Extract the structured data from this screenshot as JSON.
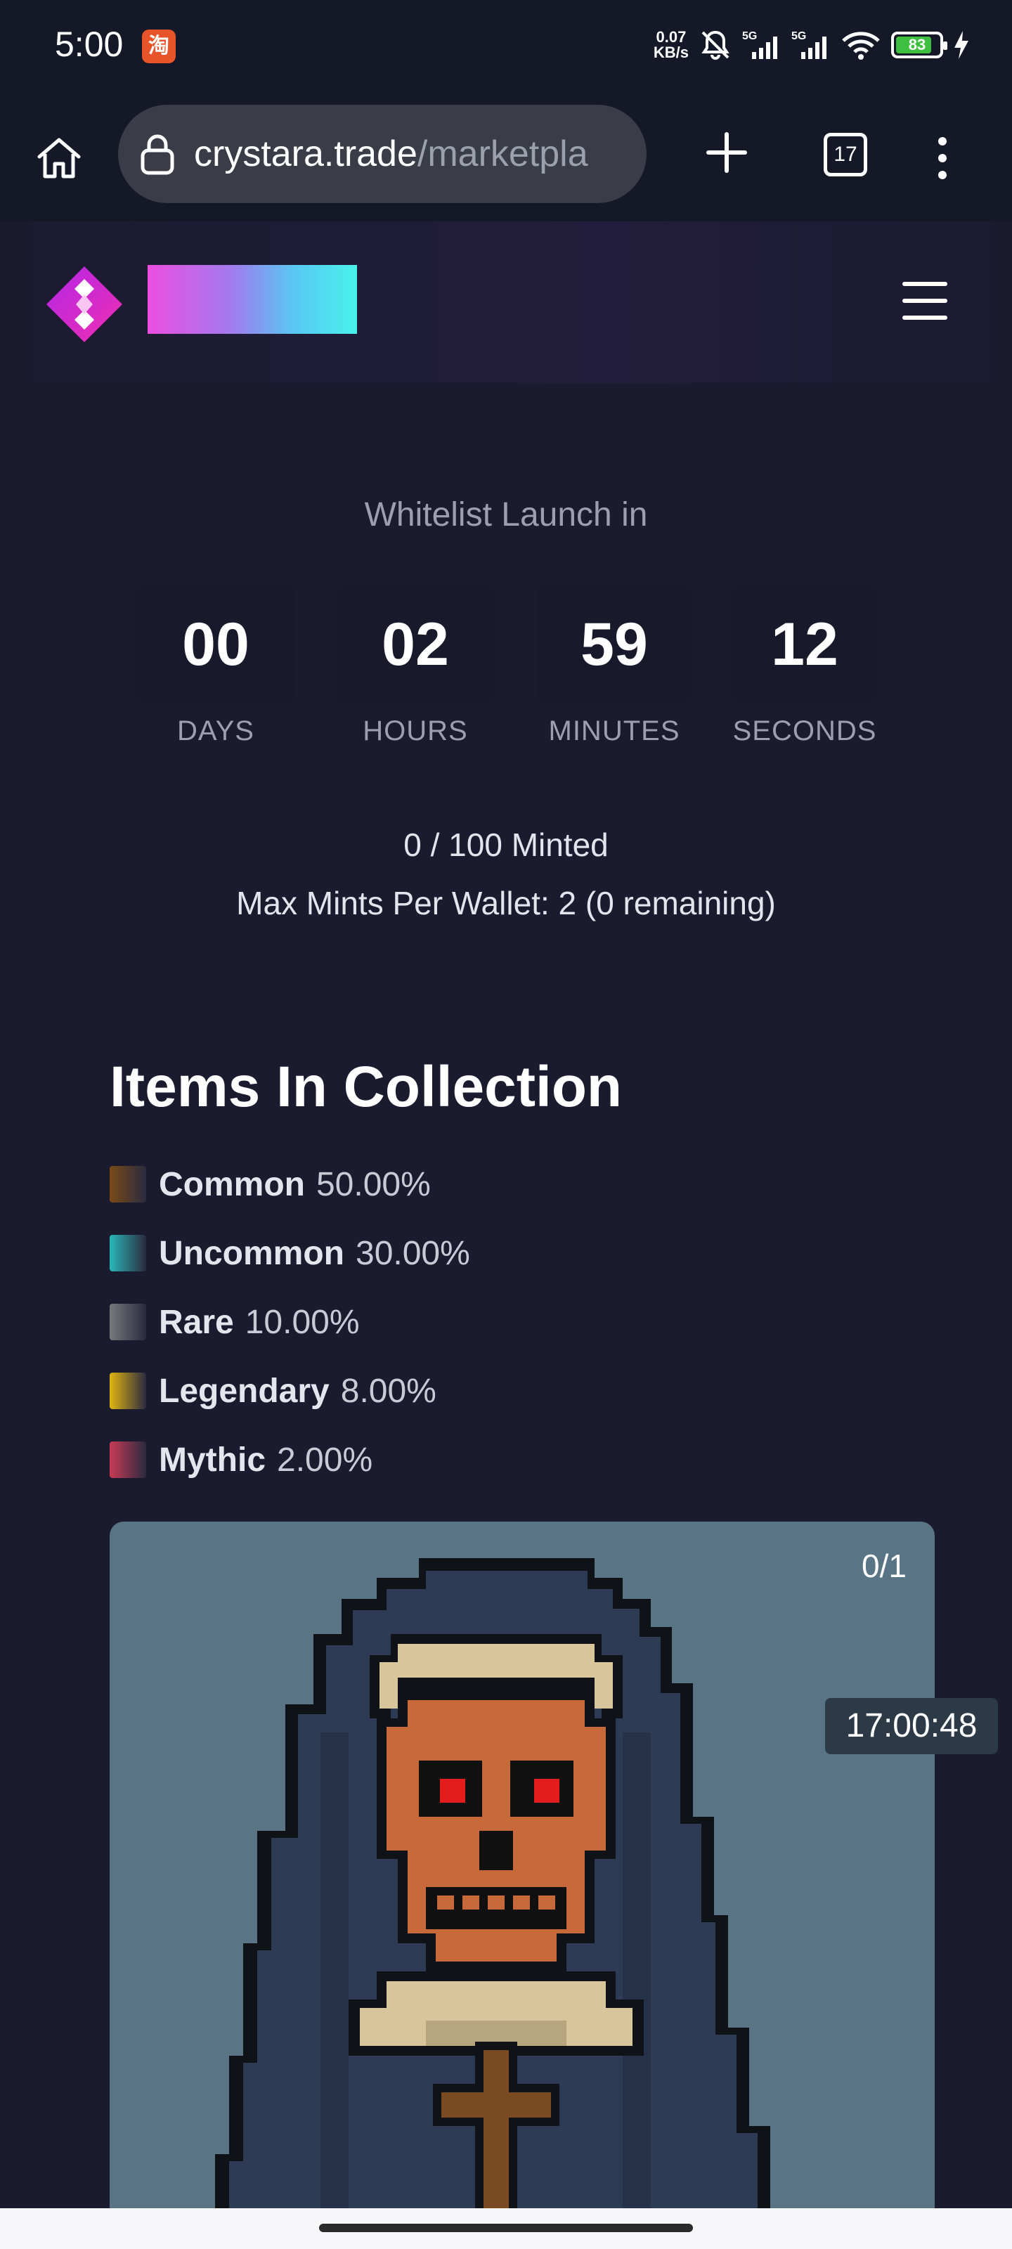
{
  "status_bar": {
    "time": "5:00",
    "app_icon_glyph": "淘",
    "net_speed_value": "0.07",
    "net_speed_unit": "KB/s",
    "battery_level": "83",
    "battery_fraction": 0.83,
    "icons": [
      "taobao-app-icon",
      "bell-muted-icon",
      "signal-5g-icon",
      "signal-5g-icon",
      "wifi-icon",
      "battery-icon",
      "charging-bolt-icon"
    ]
  },
  "browser": {
    "url_host": "crystara.trade",
    "url_path": "/marketpla",
    "tab_count": "17",
    "icons": [
      "home-icon",
      "lock-icon",
      "plus-icon",
      "tabs-icon",
      "more-vert-icon"
    ]
  },
  "header": {
    "logo_icon": "crystara-diamond-logo-icon",
    "menu_icon": "hamburger-menu-icon",
    "brand_gradient": [
      "#ec4ee0",
      "#a27bee",
      "#58c7f3",
      "#48f2ea"
    ]
  },
  "countdown": {
    "heading": "Whitelist Launch in",
    "units": [
      {
        "value": "00",
        "label": "DAYS"
      },
      {
        "value": "02",
        "label": "HOURS"
      },
      {
        "value": "59",
        "label": "MINUTES"
      },
      {
        "value": "12",
        "label": "SECONDS"
      }
    ]
  },
  "mint": {
    "minted": "0 / 100 Minted",
    "max_per_wallet": "Max Mints Per Wallet: 2 (0 remaining)"
  },
  "collection": {
    "title": "Items In Collection",
    "rarities": [
      {
        "name": "Common",
        "percent": "50.00%",
        "color": "#7a4a17"
      },
      {
        "name": "Uncommon",
        "percent": "30.00%",
        "color": "#2ab7b7"
      },
      {
        "name": "Rare",
        "percent": "10.00%",
        "color": "#77777c"
      },
      {
        "name": "Legendary",
        "percent": "8.00%",
        "color": "#e0b511"
      },
      {
        "name": "Mythic",
        "percent": "2.00%",
        "color": "#c93a55"
      }
    ],
    "card": {
      "count": "0/1",
      "timer": "17:00:48",
      "background": "#587485"
    }
  }
}
